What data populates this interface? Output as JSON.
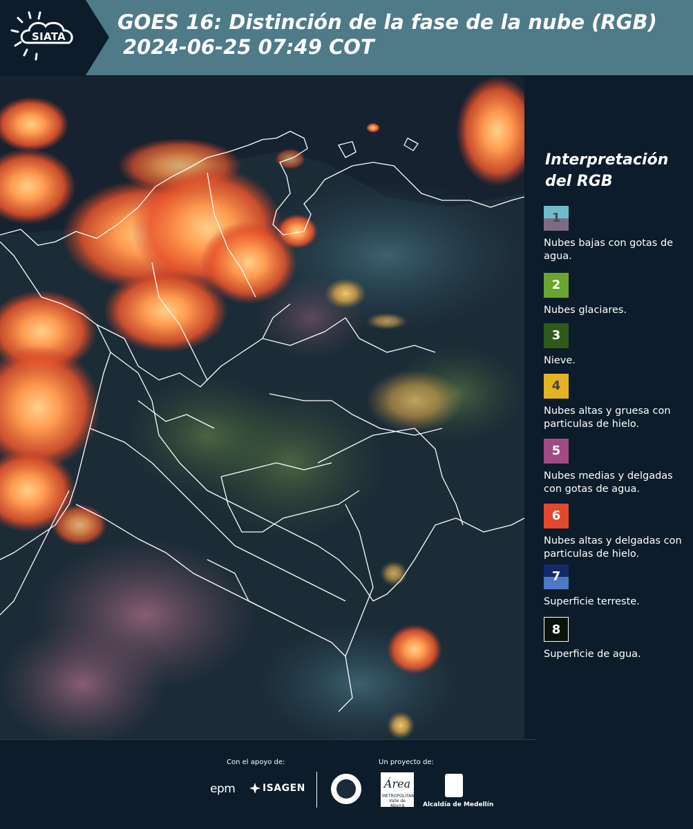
{
  "header": {
    "logo_text": "SIATA",
    "title_line1": "GOES 16: Distinción de la fase de la nube (RGB)",
    "title_line2": "2024-06-25 07:49 COT",
    "background_color": "#4f7a88",
    "logo_background_color": "#0c1c2a"
  },
  "legend": {
    "title": "Interpretación del RGB",
    "items": [
      {
        "number": "1",
        "label": "Nubes bajas con gotas de agua.",
        "color_top": "#6fbccb",
        "color_bottom": "#7d6b84",
        "number_color": "#4a4a55"
      },
      {
        "number": "2",
        "label": "Nubes glaciares.",
        "color_top": "#69a52f",
        "color_bottom": "#69a52f",
        "number_color": "#ffffff"
      },
      {
        "number": "3",
        "label": "Nieve.",
        "color_top": "#2f5a1c",
        "color_bottom": "#2f5a1c",
        "number_color": "#ffffff"
      },
      {
        "number": "4",
        "label": "Nubes altas y gruesa con particulas de hielo.",
        "color_top": "#e5b422",
        "color_bottom": "#e5b422",
        "number_color": "#444444"
      },
      {
        "number": "5",
        "label": "Nubes medias y delgadas con gotas de agua.",
        "color_top": "#a14a84",
        "color_bottom": "#a14a84",
        "number_color": "#ffffff"
      },
      {
        "number": "6",
        "label": "Nubes altas y delgadas con particulas de hielo.",
        "color_top": "#e2482d",
        "color_bottom": "#e2482d",
        "number_color": "#ffffff"
      },
      {
        "number": "7",
        "label": "Superficie terreste.",
        "color_top": "#142a6a",
        "color_bottom": "#4b79c3",
        "number_color": "#ffffff"
      },
      {
        "number": "8",
        "label": "Superficie de agua.",
        "color_top": "#0a1408",
        "color_bottom": "#0a1408",
        "number_color": "#ffffff"
      }
    ]
  },
  "footer": {
    "support_label": "Con el apoyo de:",
    "project_label": "Un proyecto de:",
    "sponsor_1": "epm",
    "sponsor_2": "ISAGEN",
    "partner_amva_mark": "Área",
    "partner_amva_text": "METROPOLITANA Valle de Aburrá",
    "partner_medellin": "Alcaldía de Medellín"
  }
}
